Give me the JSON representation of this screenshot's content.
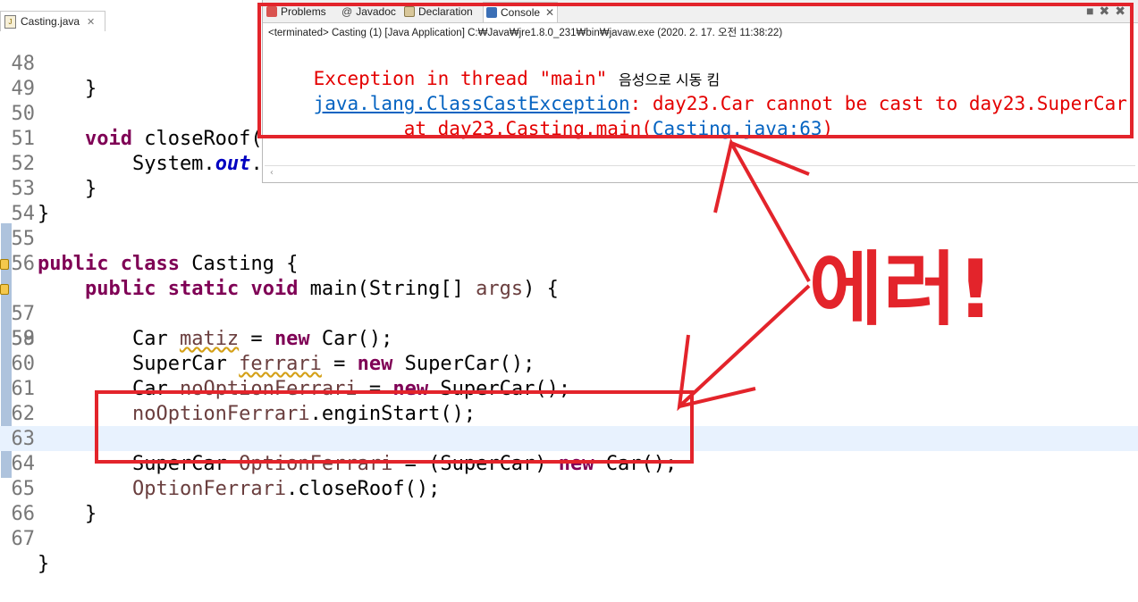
{
  "editor": {
    "tab_label": "Casting.java",
    "lines": [
      {
        "no": "48",
        "code": "    }"
      },
      {
        "no": "49",
        "code": ""
      },
      {
        "no": "50",
        "code": "    void closeRoof("
      },
      {
        "no": "51",
        "code": "        System.out."
      },
      {
        "no": "52",
        "code": "    }"
      },
      {
        "no": "53",
        "code": "}"
      },
      {
        "no": "54",
        "code": ""
      },
      {
        "no": "55",
        "code": "public class Casting {"
      },
      {
        "no": "56",
        "code": "    public static void main(String[] args) {"
      },
      {
        "no": "57",
        "code": "        Car matiz = new Car();"
      },
      {
        "no": "58",
        "code": "        SuperCar ferrari = new SuperCar();"
      },
      {
        "no": "59",
        "code": ""
      },
      {
        "no": "60",
        "code": "        Car noOptionFerrari = new SuperCar();"
      },
      {
        "no": "61",
        "code": "        noOptionFerrari.enginStart();"
      },
      {
        "no": "62",
        "code": ""
      },
      {
        "no": "63",
        "code": "        SuperCar OptionFerrari = (SuperCar) new Car();"
      },
      {
        "no": "64",
        "code": "        OptionFerrari.closeRoof();"
      },
      {
        "no": "65",
        "code": "    }"
      },
      {
        "no": "66",
        "code": ""
      },
      {
        "no": "67",
        "code": "}"
      }
    ]
  },
  "console": {
    "tabs": [
      "Problems",
      "Javadoc",
      "Declaration",
      "Console"
    ],
    "active_tab": "Console",
    "status": "<terminated> Casting (1) [Java Application] C:₩Java₩jre1.8.0_231₩bin₩javaw.exe (2020. 2. 17. 오전 11:38:22)",
    "line1_prefix": "Exception in thread \"main\" ",
    "line1_korean": "음성으로 시동 킴",
    "line2_link": "java.lang.ClassCastException",
    "line2_rest": ": day23.Car cannot be cast to day23.SuperCar",
    "line3_prefix": "        at day23.Casting.main(",
    "line3_link": "Casting.java:63",
    "line3_suffix": ")"
  },
  "annotation": {
    "text": "에러!",
    "color": "#e3242b"
  }
}
